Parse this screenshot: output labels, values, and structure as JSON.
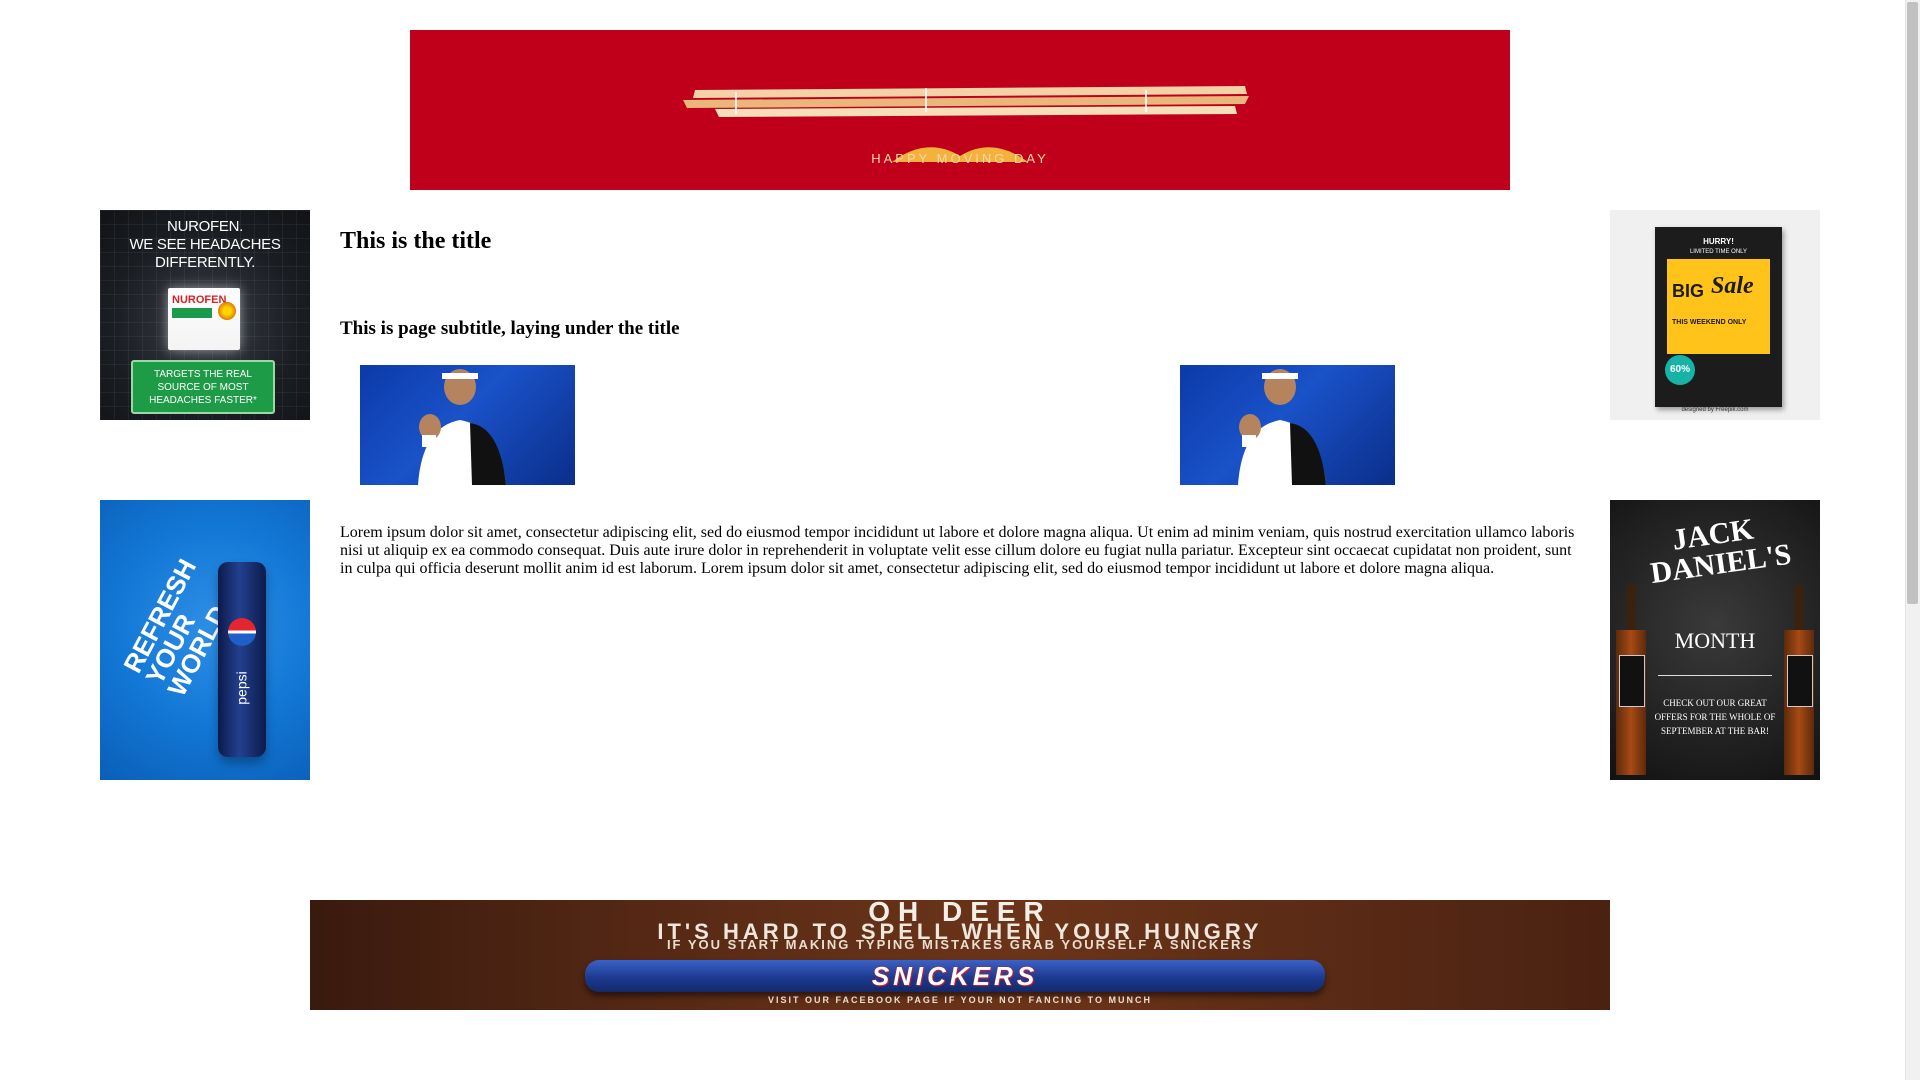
{
  "top_banner": {
    "tagline": "HAPPY MOVING DAY",
    "colors": {
      "background": "#c0001a",
      "accent": "#f2b23c"
    }
  },
  "ads": {
    "nurofen": {
      "headline": "NUROFEN.\nWE SEE HEADACHES DIFFERENTLY.",
      "brand": "NUROFEN",
      "cta": "TARGETS THE REAL SOURCE OF MOST HEADACHES FASTER*"
    },
    "big_sale": {
      "hurry": "HURRY!",
      "limited": "LIMITED TIME ONLY",
      "big": "BIG",
      "sale": "Sale",
      "weekend": "THIS WEEKEND ONLY",
      "badge": "60%",
      "credit": "designed by Freepik.com"
    },
    "pepsi": {
      "slogan": "REFRESH YOUR WORLD",
      "brand": "pepsi"
    },
    "jack_daniels": {
      "title": "JACK DANIEL'S",
      "month": "MONTH",
      "offer": "CHECK OUT OUR GREAT OFFERS FOR THE WHOLE OF SEPTEMBER AT THE BAR!"
    },
    "snickers": {
      "line1": "OH DEER",
      "line2": "IT'S HARD TO SPELL WHEN YOUR HUNGRY",
      "line3": "IF YOU START MAKING TYPING MISTAKES GRAB YOURSELF A SNICKERS",
      "brand": "SNICKERS",
      "footer": "VISIT OUR FACEBOOK PAGE IF YOUR NOT FANCING TO MUNCH"
    }
  },
  "main": {
    "title": "This is the title",
    "subtitle": "This is page subtitle, laying under the title",
    "body": "Lorem ipsum dolor sit amet, consectetur adipiscing elit, sed do eiusmod tempor incididunt ut labore et dolore magna aliqua. Ut enim ad minim veniam, quis nostrud exercitation ullamco laboris nisi ut aliquip ex ea commodo consequat. Duis aute irure dolor in reprehenderit in voluptate velit esse cillum dolore eu fugiat nulla pariatur. Excepteur sint occaecat cupidatat non proident, sunt in culpa qui officia deserunt mollit anim id est laborum. Lorem ipsum dolor sit amet, consectetur adipiscing elit, sed do eiusmod tempor incididunt ut labore et dolore magna aliqua."
  },
  "icons": {
    "photos": "tennis-player-photo",
    "scrollbar": "vertical-scrollbar"
  }
}
